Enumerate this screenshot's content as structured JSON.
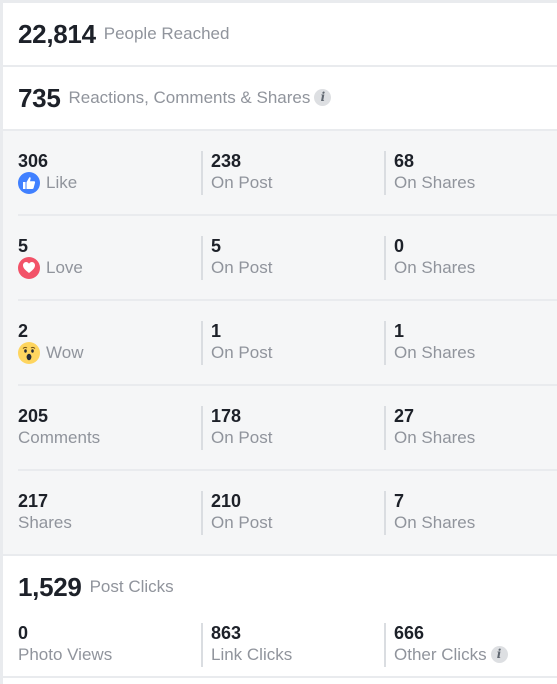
{
  "reach": {
    "value": "22,814",
    "label": "People Reached"
  },
  "engagement": {
    "value": "735",
    "label": "Reactions, Comments & Shares",
    "info_icon": "info-icon",
    "rows": [
      {
        "key": "like",
        "icon": "like-icon",
        "total": "306",
        "label": "Like",
        "on_post": "238",
        "on_post_label": "On Post",
        "on_shares": "68",
        "on_shares_label": "On Shares"
      },
      {
        "key": "love",
        "icon": "love-icon",
        "total": "5",
        "label": "Love",
        "on_post": "5",
        "on_post_label": "On Post",
        "on_shares": "0",
        "on_shares_label": "On Shares"
      },
      {
        "key": "wow",
        "icon": "wow-icon",
        "total": "2",
        "label": "Wow",
        "on_post": "1",
        "on_post_label": "On Post",
        "on_shares": "1",
        "on_shares_label": "On Shares"
      },
      {
        "key": "comments",
        "icon": null,
        "total": "205",
        "label": "Comments",
        "on_post": "178",
        "on_post_label": "On Post",
        "on_shares": "27",
        "on_shares_label": "On Shares"
      },
      {
        "key": "shares",
        "icon": null,
        "total": "217",
        "label": "Shares",
        "on_post": "210",
        "on_post_label": "On Post",
        "on_shares": "7",
        "on_shares_label": "On Shares"
      }
    ]
  },
  "clicks": {
    "value": "1,529",
    "label": "Post Clicks",
    "items": [
      {
        "value": "0",
        "label": "Photo Views"
      },
      {
        "value": "863",
        "label": "Link Clicks"
      },
      {
        "value": "666",
        "label": "Other Clicks",
        "info_icon": "info-icon"
      }
    ]
  },
  "colors": {
    "like": "#4080ff",
    "love": "#f25268",
    "wow": "#fed55f",
    "number": "#1d2129",
    "label": "#90949c"
  }
}
